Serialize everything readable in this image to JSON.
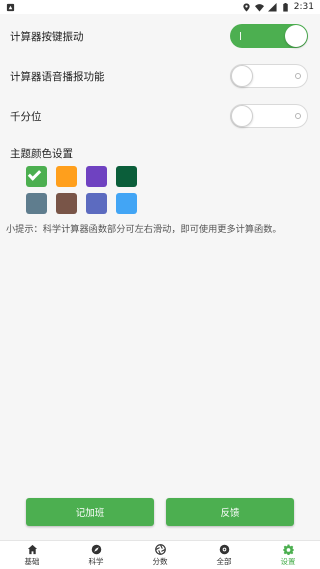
{
  "status_bar": {
    "time": "2:31",
    "icons": [
      "notification-icon",
      "location-icon",
      "wifi-icon",
      "signal-icon",
      "battery-icon"
    ]
  },
  "settings": {
    "vibration": {
      "label": "计算器按键振动",
      "on": true
    },
    "voice": {
      "label": "计算器语音播报功能",
      "on": false
    },
    "thousands": {
      "label": "千分位",
      "on": false
    }
  },
  "theme": {
    "title": "主题颜色设置",
    "colors": [
      "#4caf50",
      "#ff9f1c",
      "#6f42c1",
      "#0b5e3a",
      "#5f7d8e",
      "#795548",
      "#5c6bc0",
      "#42a5f5"
    ],
    "selected_index": 0
  },
  "tip": "小提示：科学计算器函数部分可左右滑动，即可使用更多计算函数。",
  "buttons": {
    "notes": "记加班",
    "feedback": "反馈"
  },
  "colors": {
    "accent": "#4caf50"
  },
  "nav": {
    "items": [
      {
        "label": "基础",
        "icon": "home-icon"
      },
      {
        "label": "科学",
        "icon": "compass-icon"
      },
      {
        "label": "分数",
        "icon": "aperture-icon"
      },
      {
        "label": "全部",
        "icon": "dashboard-icon"
      },
      {
        "label": "设置",
        "icon": "gear-icon"
      }
    ],
    "active_index": 4
  }
}
